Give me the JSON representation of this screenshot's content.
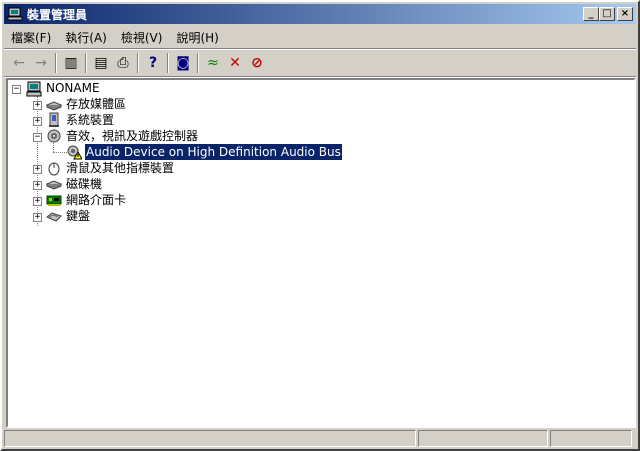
{
  "window": {
    "title": "裝置管理員",
    "buttons": {
      "minimize": "_",
      "maximize": "□",
      "close": "×"
    }
  },
  "menubar": {
    "items": [
      {
        "label": "檔案(F)"
      },
      {
        "label": "執行(A)"
      },
      {
        "label": "檢視(V)"
      },
      {
        "label": "說明(H)"
      }
    ]
  },
  "toolbar": {
    "glyphs": {
      "back": "←",
      "forward": "→",
      "show_hide": "▥",
      "properties": "▤",
      "print": "⎙",
      "help": "?",
      "scan": "◙",
      "update": "≈",
      "uninstall": "✕",
      "disable": "⊘"
    },
    "icons": [
      "back-arrow-icon",
      "forward-arrow-icon",
      "show-hide-console-tree-icon",
      "properties-icon",
      "print-icon",
      "help-icon",
      "scan-hardware-icon",
      "update-driver-icon",
      "uninstall-icon",
      "disable-device-icon"
    ]
  },
  "tree": {
    "root": {
      "label": "NONAME",
      "expander": "−",
      "icon": "computer-icon"
    },
    "items": [
      {
        "label": "存放媒體區",
        "expander": "+",
        "icon": "storage-drive-icon"
      },
      {
        "label": "系統裝置",
        "expander": "+",
        "icon": "system-device-icon"
      },
      {
        "label": "音效，視訊及遊戲控制器",
        "expander": "−",
        "icon": "sound-video-icon"
      },
      {
        "label": "滑鼠及其他指標裝置",
        "expander": "+",
        "icon": "mouse-icon"
      },
      {
        "label": "磁碟機",
        "expander": "+",
        "icon": "disk-drive-icon"
      },
      {
        "label": "網路介面卡",
        "expander": "+",
        "icon": "network-adapter-icon"
      },
      {
        "label": "鍵盤",
        "expander": "+",
        "icon": "keyboard-icon"
      }
    ],
    "child": {
      "label": "Audio Device on High Definition Audio Bus",
      "icon": "audio-device-warning-icon",
      "status": "warning"
    }
  },
  "colors": {
    "title_start": "#0a246a",
    "title_end": "#a6caf0",
    "selection": "#0a246a",
    "face": "#d4d0c8"
  }
}
